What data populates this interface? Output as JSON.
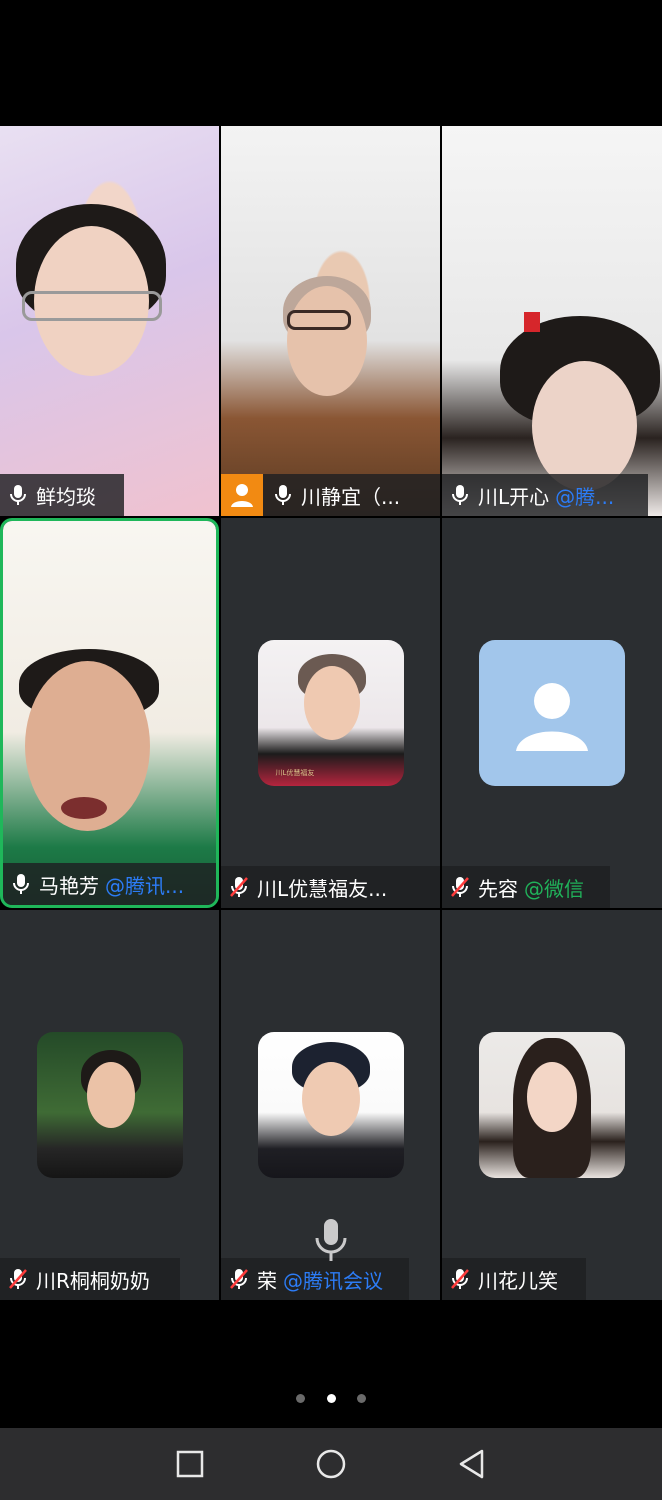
{
  "participants": [
    {
      "name": "鲜均琰",
      "org": "",
      "mic": "on",
      "host": false
    },
    {
      "name": "川静宜（...",
      "org": "",
      "mic": "on",
      "host": true
    },
    {
      "name": "川L开心",
      "org": "@腾...",
      "mic": "on",
      "host": false
    },
    {
      "name": "马艳芳",
      "org": "@腾讯...",
      "mic": "on",
      "host": false,
      "speaking": true
    },
    {
      "name": "川L优慧福友...",
      "org": "",
      "mic": "muted",
      "host": false,
      "avatar_caption": "川L优慧福友"
    },
    {
      "name": "先容",
      "org": "@微信",
      "mic": "muted",
      "host": false,
      "avatar": "default-user-icon"
    },
    {
      "name": "川R桐桐奶奶",
      "org": "",
      "mic": "muted",
      "host": false
    },
    {
      "name": "荣",
      "org": "@腾讯会议",
      "mic": "muted",
      "host": false
    },
    {
      "name": "川花儿笑",
      "org": "",
      "mic": "muted",
      "host": false
    }
  ],
  "pager": {
    "total": 3,
    "current": 2
  },
  "colors": {
    "speaking_border": "#1fb75a",
    "org_blue": "#2c7cf6",
    "org_green": "#20b25a",
    "host_badge": "#f28a12",
    "default_avatar_bg": "#a2c6eb"
  },
  "icons": {
    "mic_on": "microphone-icon",
    "mic_muted": "microphone-muted-icon",
    "host": "host-person-icon",
    "nav": [
      "recent-apps-icon",
      "home-icon",
      "back-icon"
    ]
  }
}
